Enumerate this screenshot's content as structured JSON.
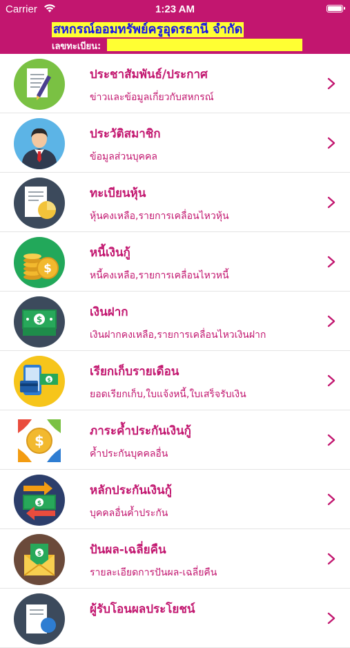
{
  "status_bar": {
    "carrier": "Carrier",
    "time": "1:23 AM",
    "icons": [
      "wifi-icon",
      "battery-icon"
    ]
  },
  "header": {
    "title": "สหกรณ์ออมทรัพย์ครูอุดรธานี จำกัด",
    "registration_label": "เลขทะเบียน:",
    "registration_value": ""
  },
  "colors": {
    "brand": "#c2166f",
    "highlight": "#ffff33",
    "title_text": "#1515e8",
    "chevron": "#c2166f"
  },
  "menu": [
    {
      "title": "ประชาสัมพันธ์/ประกาศ",
      "subtitle": "ข่าวและข้อมูลเกี่ยวกับสหกรณ์",
      "icon": "announcement-icon"
    },
    {
      "title": "ประวัติสมาชิก",
      "subtitle": "ข้อมูลส่วนบุคคล",
      "icon": "member-profile-icon"
    },
    {
      "title": "ทะเบียนหุ้น",
      "subtitle": "หุ้นคงเหลือ,รายการเคลื่อนไหวหุ้น",
      "icon": "share-register-icon"
    },
    {
      "title": "หนี้เงินกู้",
      "subtitle": "หนี้คงเหลือ,รายการเคลื่อนไหวหนี้",
      "icon": "loan-debt-icon"
    },
    {
      "title": "เงินฝาก",
      "subtitle": "เงินฝากคงเหลือ,รายการเคลื่อนไหวเงินฝาก",
      "icon": "deposit-icon"
    },
    {
      "title": "เรียกเก็บรายเดือน",
      "subtitle": "ยอดเรียกเก็บ,ใบแจ้งหนี้,ใบเสร็จรับเงิน",
      "icon": "monthly-billing-icon"
    },
    {
      "title": "ภาระค้ำประกันเงินกู้",
      "subtitle": "ค้ำประกันบุคคลอื่น",
      "icon": "guarantee-obligation-icon"
    },
    {
      "title": "หลักประกันเงินกู้",
      "subtitle": "บุคคลอื่นค้ำประกัน",
      "icon": "loan-collateral-icon"
    },
    {
      "title": "ปันผล-เฉลี่ยคืน",
      "subtitle": "รายละเอียดการปันผล-เฉลี่ยคืน",
      "icon": "dividend-icon"
    },
    {
      "title": "ผู้รับโอนผลประโยชน์",
      "subtitle": "",
      "icon": "beneficiary-icon"
    }
  ]
}
